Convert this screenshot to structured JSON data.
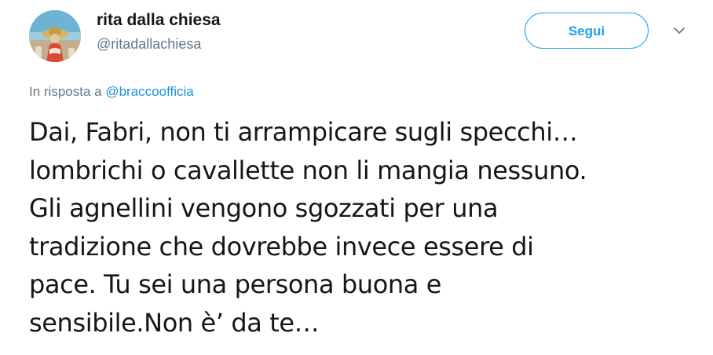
{
  "author": {
    "display_name": "rita dalla chiesa",
    "screen_name": "@ritadallachiesa"
  },
  "follow_button": {
    "label": "Segui"
  },
  "icons": {
    "menu": "chevron-down-icon"
  },
  "reply_context": {
    "prefix": "In risposta a ",
    "mention": "@braccoofficia"
  },
  "tweet": {
    "lines": [
      "Dai, Fabri, non ti arrampicare sugli specchi…",
      "lombrichi o cavallette non li mangia nessuno.",
      "Gli agnellini vengono sgozzati per una",
      "tradizione che dovrebbe invece essere di",
      "pace. Tu sei una persona buona e",
      "sensibile.Non è’ da te…"
    ]
  },
  "colors": {
    "accent": "#1da1f2",
    "link": "#1b95e0",
    "text": "#14171a",
    "secondary": "#657786"
  }
}
